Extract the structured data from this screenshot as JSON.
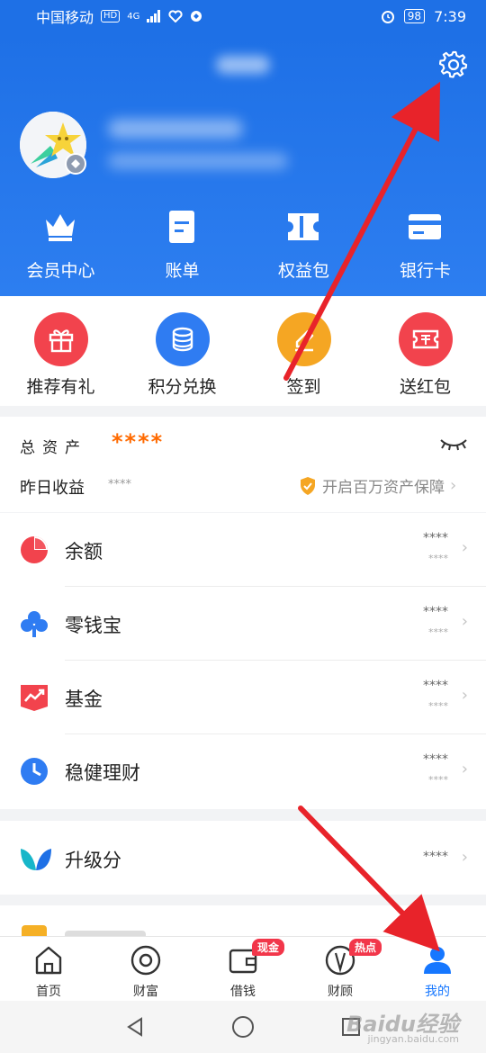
{
  "status_bar": {
    "carrier": "中国移动",
    "hd": "HD",
    "network": "4G",
    "battery": "98",
    "time": "7:39"
  },
  "header": {
    "quick_actions": [
      {
        "label": "会员中心",
        "icon": "crown-icon"
      },
      {
        "label": "账单",
        "icon": "bill-icon"
      },
      {
        "label": "权益包",
        "icon": "ticket-icon"
      },
      {
        "label": "银行卡",
        "icon": "bank-card-icon"
      }
    ]
  },
  "services": [
    {
      "label": "推荐有礼",
      "icon": "gift-icon",
      "color": "#f2434d"
    },
    {
      "label": "积分兑换",
      "icon": "coins-icon",
      "color": "#2f7cf2"
    },
    {
      "label": "签到",
      "icon": "pen-icon",
      "color": "#f5a623"
    },
    {
      "label": "送红包",
      "icon": "red-ticket-icon",
      "color": "#f2434d"
    }
  ],
  "assets": {
    "title": "总资产",
    "total_masked": "****",
    "yesterday_label": "昨日收益",
    "yesterday_value": "****",
    "guard_text": "开启百万资产保障"
  },
  "list": [
    {
      "name": "余额",
      "icon": "pie-icon",
      "v1": "****",
      "v2": "****"
    },
    {
      "name": "零钱宝",
      "icon": "clover-icon",
      "v1": "****",
      "v2": "****"
    },
    {
      "name": "基金",
      "icon": "trend-icon",
      "v1": "****",
      "v2": "****"
    },
    {
      "name": "稳健理财",
      "icon": "clock-icon",
      "v1": "****",
      "v2": "****"
    }
  ],
  "upgrade": {
    "name": "升级分",
    "icon": "leaf-icon",
    "v1": "****"
  },
  "tabbar": [
    {
      "label": "首页",
      "icon": "home-icon"
    },
    {
      "label": "财富",
      "icon": "wealth-icon"
    },
    {
      "label": "借钱",
      "icon": "wallet-icon",
      "badge": "现金"
    },
    {
      "label": "财顾",
      "icon": "advisor-icon",
      "badge": "热点"
    },
    {
      "label": "我的",
      "icon": "user-icon",
      "active": true
    }
  ],
  "watermark": {
    "main": "Baidu经验",
    "sub": "jingyan.baidu.com"
  },
  "colors": {
    "primary": "#1e70e6",
    "accent": "#ff6a00",
    "red": "#f2434d",
    "arrow": "#e8232a"
  }
}
